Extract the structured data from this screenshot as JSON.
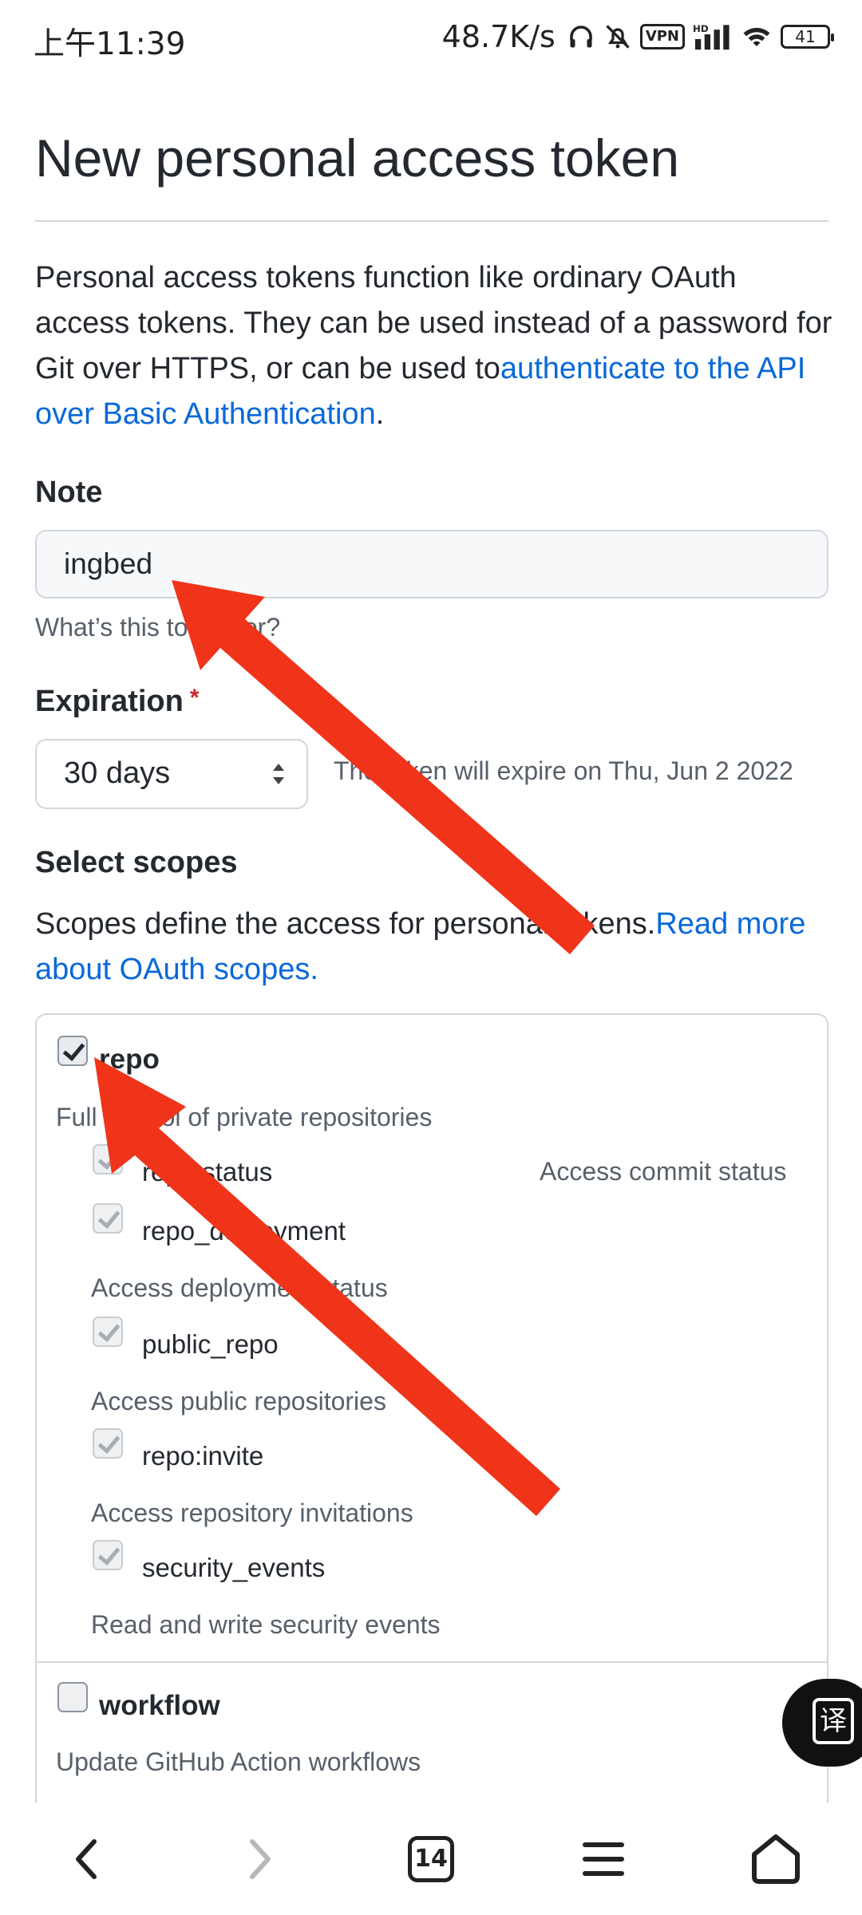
{
  "status_bar": {
    "time": "上午11:39",
    "speed": "48.7K/s",
    "vpn": "VPN",
    "signal_label": "HD",
    "battery": "41"
  },
  "page": {
    "title": "New personal access token",
    "intro_text": "Personal access tokens function like ordinary OAuth access tokens. They can be used instead of a password for Git over HTTPS, or can be used to",
    "intro_link": "authenticate to the API over Basic Authentication",
    "intro_end": "."
  },
  "note": {
    "label": "Note",
    "value": "ingbed",
    "hint": "What’s this token for?"
  },
  "expiration": {
    "label": "Expiration",
    "required_mark": "*",
    "selected": "30 days",
    "hint": "The token will expire on Thu, Jun 2 2022"
  },
  "scopes": {
    "label": "Select scopes",
    "desc_text": "Scopes define the access for personal tokens.",
    "desc_link": "Read more about OAuth scopes.",
    "repo": {
      "name": "repo",
      "checked": true,
      "desc": "Full control of private repositories",
      "subs": [
        {
          "name": "repo:status",
          "desc": "Access commit status"
        },
        {
          "name": "repo_deployment",
          "desc": "Access deployment status"
        },
        {
          "name": "public_repo",
          "desc": "Access public repositories"
        },
        {
          "name": "repo:invite",
          "desc": "Access repository invitations"
        },
        {
          "name": "security_events",
          "desc": "Read and write security events"
        }
      ]
    },
    "workflow": {
      "name": "workflow",
      "checked": false,
      "desc": "Update GitHub Action workflows"
    }
  },
  "fab": {
    "glyph": "译"
  },
  "bottom_nav": {
    "tab_count": "14"
  },
  "colors": {
    "link": "#0969da",
    "annotation_arrow": "#f0341a",
    "required": "#cf222e"
  }
}
